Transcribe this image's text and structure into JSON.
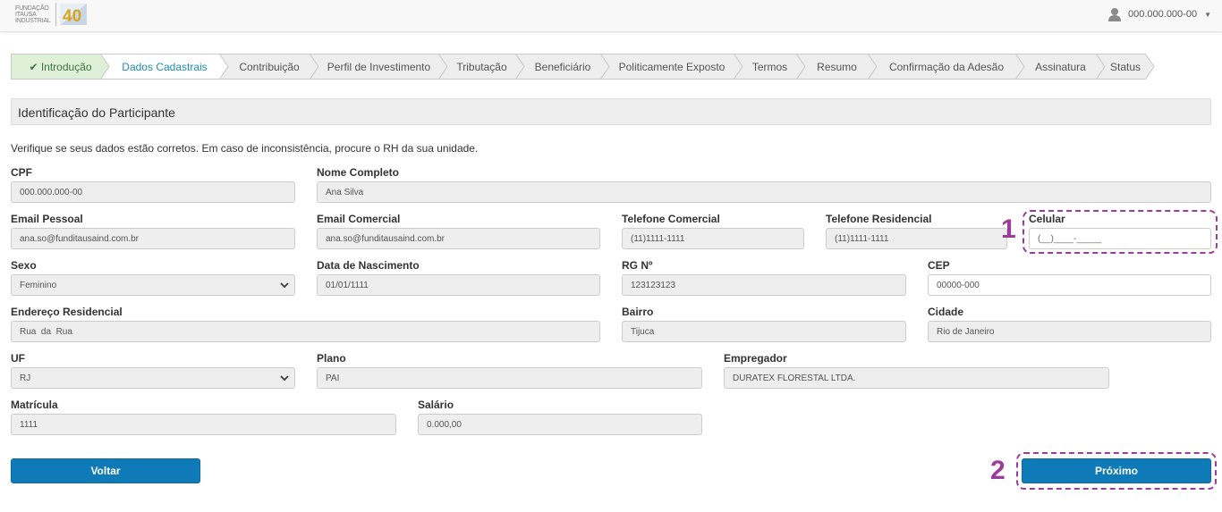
{
  "header": {
    "logo_text": [
      "FUNDAÇÃO",
      "ITAÚSA",
      "INDUSTRIAL"
    ],
    "logo_badge": "40",
    "user_name": "000.000.000-00"
  },
  "steps": [
    {
      "label": "Introdução",
      "state": "done"
    },
    {
      "label": "Dados Cadastrais",
      "state": "active"
    },
    {
      "label": "Contribuição",
      "state": "pending"
    },
    {
      "label": "Perfil de Investimento",
      "state": "pending"
    },
    {
      "label": "Tributação",
      "state": "pending"
    },
    {
      "label": "Beneficiário",
      "state": "pending"
    },
    {
      "label": "Politicamente Exposto",
      "state": "pending"
    },
    {
      "label": "Termos",
      "state": "pending"
    },
    {
      "label": "Resumo",
      "state": "pending"
    },
    {
      "label": "Confirmação da Adesão",
      "state": "pending"
    },
    {
      "label": "Assinatura",
      "state": "pending"
    },
    {
      "label": "Status",
      "state": "pending"
    }
  ],
  "section": {
    "title": "Identificação do Participante",
    "instructions": "Verifique se seus dados estão corretos. Em caso de inconsistência, procure o RH da sua unidade."
  },
  "fields": {
    "cpf": {
      "label": "CPF",
      "value": "000.000.000-00"
    },
    "nome": {
      "label": "Nome Completo",
      "value": "Ana Silva"
    },
    "email_pessoal": {
      "label": "Email Pessoal",
      "value": "ana.so@funditausaind.com.br"
    },
    "email_comercial": {
      "label": "Email Comercial",
      "value": "ana.so@funditausaind.com.br"
    },
    "tel_comercial": {
      "label": "Telefone Comercial",
      "value": "(11)1111-1111"
    },
    "tel_residencial": {
      "label": "Telefone Residencial",
      "value": "(11)1111-1111"
    },
    "celular": {
      "label": "Celular",
      "placeholder": "(__)____-_____"
    },
    "sexo": {
      "label": "Sexo",
      "value": "Feminino"
    },
    "nascimento": {
      "label": "Data de Nascimento",
      "value": "01/01/1111"
    },
    "rg": {
      "label": "RG Nº",
      "value": "123123123"
    },
    "cep": {
      "label": "CEP",
      "value": "00000-000"
    },
    "endereco": {
      "label": "Endereço Residencial",
      "value": "Rua  da  Rua"
    },
    "bairro": {
      "label": "Bairro",
      "value": "Tijuca"
    },
    "cidade": {
      "label": "Cidade",
      "value": "Rio de Janeiro"
    },
    "uf": {
      "label": "UF",
      "value": "RJ"
    },
    "plano": {
      "label": "Plano",
      "value": "PAI"
    },
    "empregador": {
      "label": "Empregador",
      "value": "DURATEX FLORESTAL LTDA."
    },
    "matricula": {
      "label": "Matrícula",
      "value": "1111"
    },
    "salario": {
      "label": "Salário",
      "value": "0.000,00"
    }
  },
  "buttons": {
    "back": "Voltar",
    "next": "Próximo"
  },
  "annotations": {
    "one": "1",
    "two": "2"
  },
  "colors": {
    "primary": "#0f7ab8",
    "done_bg": "#dff0d8",
    "done_text": "#3c763d",
    "highlight": "#9b3b9b"
  }
}
